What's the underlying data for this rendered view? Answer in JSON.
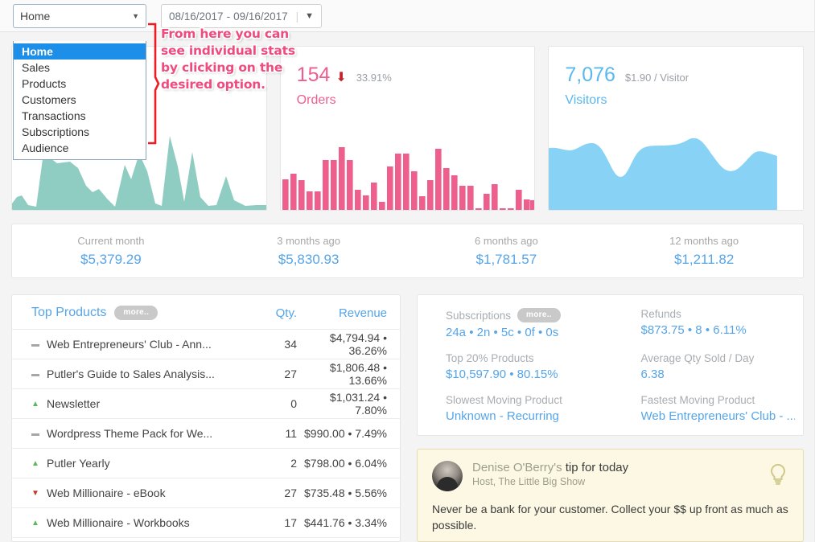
{
  "toolbar": {
    "section_select": {
      "value": "Home",
      "caret_icon": "chevron-down-icon",
      "options": [
        "Home",
        "Sales",
        "Products",
        "Customers",
        "Transactions",
        "Subscriptions",
        "Audience"
      ],
      "selected_index": 0
    },
    "date_range": {
      "start": "08/16/2017",
      "separator": "-",
      "end": "09/16/2017",
      "caret_icon": "chevron-down-icon"
    }
  },
  "annotation": {
    "text": "From here you can see individual stats by clicking on the desired option.",
    "color": "#ef4b7f",
    "brace_color": "#ed1c24"
  },
  "kpis": [
    {
      "name": "sales",
      "value": "",
      "delta": "%",
      "label": "",
      "color": "#7ec9bd",
      "chart_type": "area"
    },
    {
      "name": "orders",
      "value": "154",
      "trend_icon": "arrow-down-icon",
      "delta": "33.91%",
      "label": "Orders",
      "color": "#ef5f8e",
      "chart_type": "bar"
    },
    {
      "name": "visitors",
      "value": "7,076",
      "delta": "$1.90 / Visitor",
      "label": "Visitors",
      "color": "#5ab8ef",
      "chart_type": "area"
    }
  ],
  "months": [
    {
      "label": "Current month",
      "value": "$5,379.29"
    },
    {
      "label": "3 months ago",
      "value": "$5,830.93"
    },
    {
      "label": "6 months ago",
      "value": "$1,781.57"
    },
    {
      "label": "12 months ago",
      "value": "$1,211.82"
    }
  ],
  "top_products": {
    "title": "Top Products",
    "more_label": "more..",
    "col_qty": "Qty.",
    "col_revenue": "Revenue",
    "rows": [
      {
        "trend": "flat",
        "name": "Web Entrepreneurs' Club - Ann...",
        "qty": "34",
        "revenue": "$4,794.94 • 36.26%"
      },
      {
        "trend": "flat",
        "name": "Putler's Guide to Sales Analysis...",
        "qty": "27",
        "revenue": "$1,806.48 • 13.66%"
      },
      {
        "trend": "up",
        "name": "Newsletter",
        "qty": "0",
        "revenue": "$1,031.24 • 7.80%"
      },
      {
        "trend": "flat",
        "name": "Wordpress Theme Pack for We...",
        "qty": "11",
        "revenue": "$990.00 • 7.49%"
      },
      {
        "trend": "up",
        "name": "Putler Yearly",
        "qty": "2",
        "revenue": "$798.00 • 6.04%"
      },
      {
        "trend": "down",
        "name": "Web Millionaire - eBook",
        "qty": "27",
        "revenue": "$735.48 • 5.56%"
      },
      {
        "trend": "up",
        "name": "Web Millionaire - Workbooks",
        "qty": "17",
        "revenue": "$441.76 • 3.34%"
      }
    ]
  },
  "metrics": [
    {
      "label": "Subscriptions",
      "more_label": "more..",
      "value": "24a • 2n • 5c • 0f • 0s"
    },
    {
      "label": "Refunds",
      "value": "$873.75 • 8 • 6.11%"
    },
    {
      "label": "Top 20% Products",
      "value": "$10,597.90 • 80.15%"
    },
    {
      "label": "Average Qty Sold / Day",
      "value": "6.38"
    },
    {
      "label": "Slowest Moving Product",
      "value": "Unknown - Recurring"
    },
    {
      "label": "Fastest Moving Product",
      "value": "Web Entrepreneurs' Club - ..."
    }
  ],
  "tip": {
    "author": "Denise O'Berry's",
    "headline_rest": "tip for today",
    "role": "Host, The Little Big Show",
    "body": "Never be a bank for your customer. Collect your $$ up front as much as possible.",
    "bulb_icon": "lightbulb-icon",
    "avatar_icon": "avatar"
  },
  "chart_data": [
    {
      "type": "area",
      "title": "Sales sparkline",
      "color": "#8fcdc2",
      "x": [
        0,
        1,
        2,
        3,
        4,
        5,
        6,
        7,
        8,
        9,
        10,
        11,
        12,
        13,
        14,
        15,
        16,
        17,
        18,
        19,
        20,
        21,
        22,
        23,
        24,
        25,
        26,
        27,
        28,
        29,
        30
      ],
      "values": [
        8,
        11,
        6,
        2,
        2,
        40,
        33,
        28,
        29,
        30,
        25,
        14,
        10,
        12,
        7,
        2,
        26,
        17,
        32,
        22,
        4,
        3,
        56,
        30,
        5,
        37,
        8,
        3,
        4,
        19,
        6,
        2
      ]
    },
    {
      "type": "bar",
      "title": "Orders per day",
      "color": "#ef5f8e",
      "categories": [
        "1",
        "2",
        "3",
        "4",
        "5",
        "6",
        "7",
        "8",
        "9",
        "10",
        "11",
        "12",
        "13",
        "14",
        "15",
        "16",
        "17",
        "18",
        "19",
        "20",
        "21",
        "22",
        "23",
        "24",
        "25",
        "26",
        "27",
        "28",
        "29",
        "30",
        "31",
        "32"
      ],
      "values": [
        38,
        45,
        37,
        23,
        23,
        62,
        62,
        78,
        62,
        25,
        18,
        34,
        10,
        54,
        70,
        70,
        48,
        17,
        37,
        76,
        52,
        43,
        30,
        30,
        2,
        20,
        32,
        2,
        2,
        25,
        13,
        12
      ]
    },
    {
      "type": "area",
      "title": "Visitors",
      "color": "#88d3f5",
      "x": [
        0,
        1,
        2,
        3,
        4,
        5,
        6,
        7,
        8,
        9,
        10,
        11,
        12,
        13,
        14,
        15,
        16,
        17,
        18,
        19,
        20
      ],
      "values": [
        76,
        72,
        70,
        76,
        80,
        78,
        58,
        32,
        30,
        52,
        78,
        78,
        80,
        84,
        88,
        72,
        52,
        42,
        44,
        70,
        72
      ]
    }
  ]
}
